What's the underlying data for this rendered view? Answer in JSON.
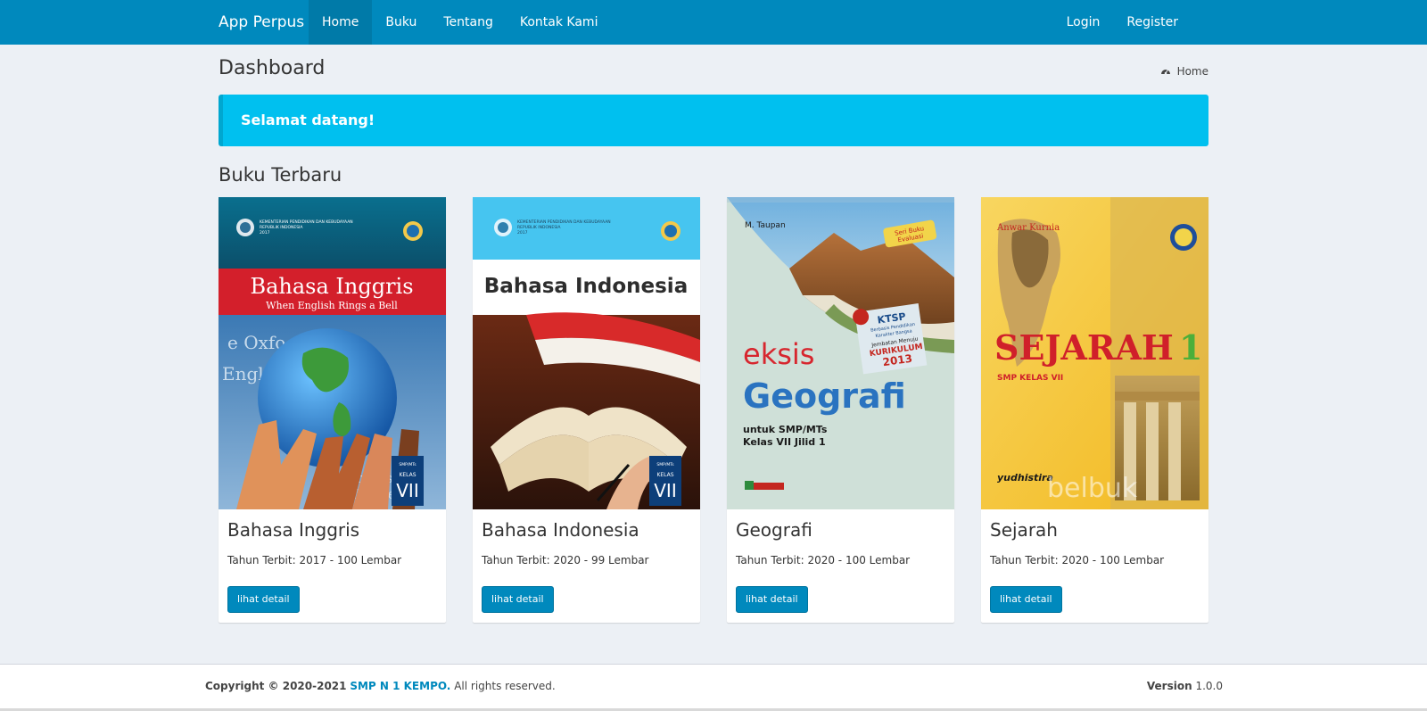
{
  "navbar": {
    "brand": "App Perpus",
    "items": [
      {
        "label": "Home",
        "active": true
      },
      {
        "label": "Buku"
      },
      {
        "label": "Tentang"
      },
      {
        "label": "Kontak Kami"
      }
    ],
    "right_items": [
      {
        "label": "Login"
      },
      {
        "label": "Register"
      }
    ],
    "color": "#0089bd"
  },
  "page": {
    "title": "Dashboard",
    "breadcrumb": "Home",
    "breadcrumb_icon": "dashboard-icon"
  },
  "callout": {
    "text": "Selamat datang!",
    "color": "#00c0ef"
  },
  "section": {
    "title": "Buku Terbaru"
  },
  "books": [
    {
      "title": "Bahasa Inggris",
      "meta": "Tahun Terbit: 2017 - 100 Lembar",
      "button": "lihat detail",
      "cover": {
        "header": "KEMENTERIAN PENDIDIKAN DAN KEBUDAYAAN",
        "header2": "REPUBLIK INDONESIA",
        "year": "2017",
        "title": "Bahasa Inggris",
        "subtitle": "When English Rings a Bell",
        "badge_top": "SMP/MTs",
        "badge_mid": "KELAS",
        "badge_num": "VII"
      }
    },
    {
      "title": "Bahasa Indonesia",
      "meta": "Tahun Terbit: 2020 - 99 Lembar",
      "button": "lihat detail",
      "cover": {
        "header": "KEMENTERIAN PENDIDIKAN DAN KEBUDAYAAN",
        "header2": "REPUBLIK INDONESIA",
        "year": "2017",
        "title": "Bahasa Indonesia",
        "badge_top": "SMP/MTs",
        "badge_mid": "KELAS",
        "badge_num": "VII"
      }
    },
    {
      "title": "Geografi",
      "meta": "Tahun Terbit: 2020 - 100 Lembar",
      "button": "lihat detail",
      "cover": {
        "author": "M. Taupan",
        "tag1": "Seri Buku",
        "tag2": "Evaluasi",
        "ktsp": "KTSP",
        "ktsp2": "Berbasis Pendidikan",
        "ktsp3": "Karakter Bangsa",
        "ktsp4": "Jembatan Menuju",
        "ktsp5": "KURIKULUM",
        "ktsp6": "2013",
        "brand": "eksis",
        "title": "Geografi",
        "line1": "untuk SMP/MTs",
        "line2": "Kelas VII Jilid 1"
      }
    },
    {
      "title": "Sejarah",
      "meta": "Tahun Terbit: 2020 - 100 Lembar",
      "button": "lihat detail",
      "cover": {
        "author": "Anwar Kurnia",
        "title": "SEJARAH",
        "number": "1",
        "subtitle": "SMP KELAS VII",
        "publisher": "yudhistira",
        "watermark": "belbuk"
      }
    }
  ],
  "footer": {
    "copyright_prefix": "Copyright © 2020-2021",
    "org": "SMP N 1 KEMPO.",
    "rights": "All rights reserved.",
    "version_label": "Version",
    "version": "1.0.0"
  }
}
